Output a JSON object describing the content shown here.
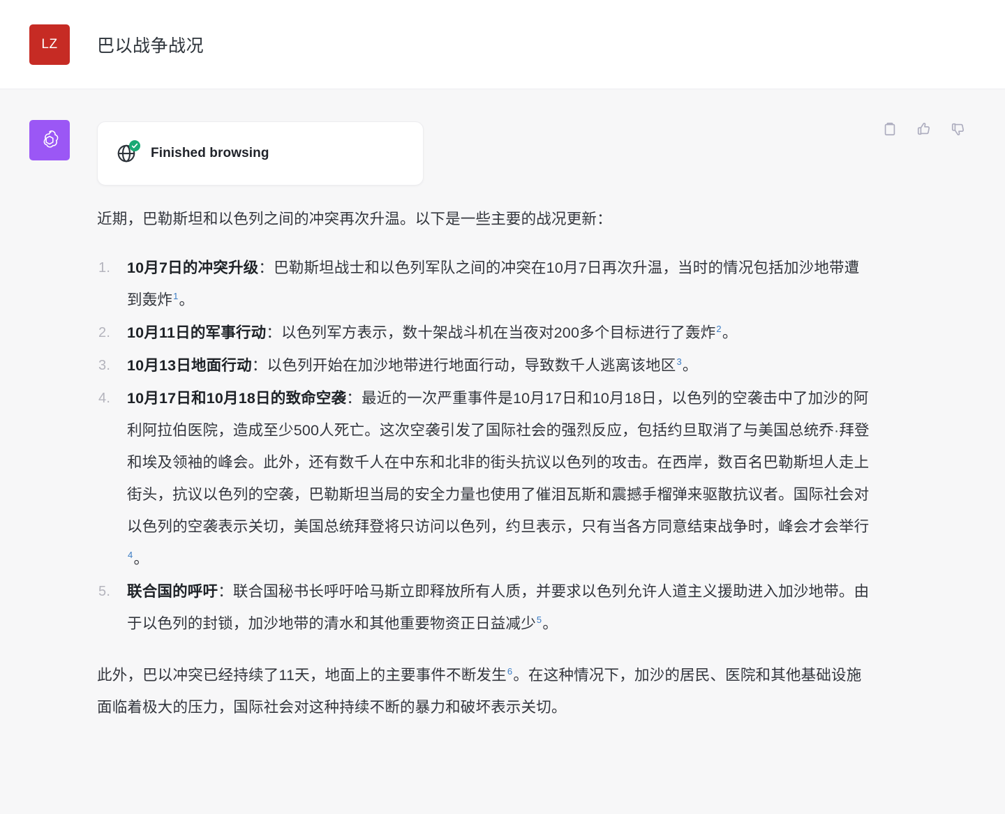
{
  "header": {
    "user_initials": "LZ",
    "avatar_color": "#c62b24",
    "title": "巴以战争战况"
  },
  "message": {
    "assistant_avatar_color": "#9b57f5",
    "assistant_avatar_icon": "openai-logo-icon",
    "actions": [
      {
        "name": "copy-button",
        "icon": "clipboard-icon"
      },
      {
        "name": "thumbs-up-button",
        "icon": "thumbs-up-icon"
      },
      {
        "name": "thumbs-down-button",
        "icon": "thumbs-down-icon"
      }
    ],
    "browsing_card": {
      "icon": "globe-icon",
      "badge_icon": "check-circle-icon",
      "badge_color": "#19a974",
      "label": "Finished browsing"
    },
    "intro": "近期，巴勒斯坦和以色列之间的冲突再次升温。以下是一些主要的战况更新：",
    "list": [
      {
        "marker": "1.",
        "heading": "10月7日的冲突升级",
        "separator": "：",
        "body": "巴勒斯坦战士和以色列军队之间的冲突在10月7日再次升温，当时的情况包括加沙地带遭到轰炸",
        "citation": "1",
        "tail": "。"
      },
      {
        "marker": "2.",
        "heading": "10月11日的军事行动",
        "separator": "：",
        "body": "以色列军方表示，数十架战斗机在当夜对200多个目标进行了轰炸",
        "citation": "2",
        "tail": "。"
      },
      {
        "marker": "3.",
        "heading": "10月13日地面行动",
        "separator": "：",
        "body": "以色列开始在加沙地带进行地面行动，导致数千人逃离该地区",
        "citation": "3",
        "tail": "。"
      },
      {
        "marker": "4.",
        "heading": "10月17日和10月18日的致命空袭",
        "separator": "：",
        "body": "最近的一次严重事件是10月17日和10月18日，以色列的空袭击中了加沙的阿利阿拉伯医院，造成至少500人死亡。这次空袭引发了国际社会的强烈反应，包括约旦取消了与美国总统乔·拜登和埃及领袖的峰会。此外，还有数千人在中东和北非的街头抗议以色列的攻击。在西岸，数百名巴勒斯坦人走上街头，抗议以色列的空袭，巴勒斯坦当局的安全力量也使用了催泪瓦斯和震撼手榴弹来驱散抗议者。国际社会对以色列的空袭表示关切，美国总统拜登将只访问以色列，约旦表示，只有当各方同意结束战争时，峰会才会举行",
        "citation": "4",
        "tail": "。"
      },
      {
        "marker": "5.",
        "heading": "联合国的呼吁",
        "separator": "：",
        "body": "联合国秘书长呼吁哈马斯立即释放所有人质，并要求以色列允许人道主义援助进入加沙地带。由于以色列的封锁，加沙地带的清水和其他重要物资正日益减少",
        "citation": "5",
        "tail": "。"
      }
    ],
    "closing": {
      "part1": "此外，巴以冲突已经持续了11天，地面上的主要事件不断发生",
      "citation": "6",
      "part2": "。在这种情况下，加沙的居民、医院和其他基础设施面临着极大的压力，国际社会对这种持续不断的暴力和破坏表示关切。"
    }
  }
}
